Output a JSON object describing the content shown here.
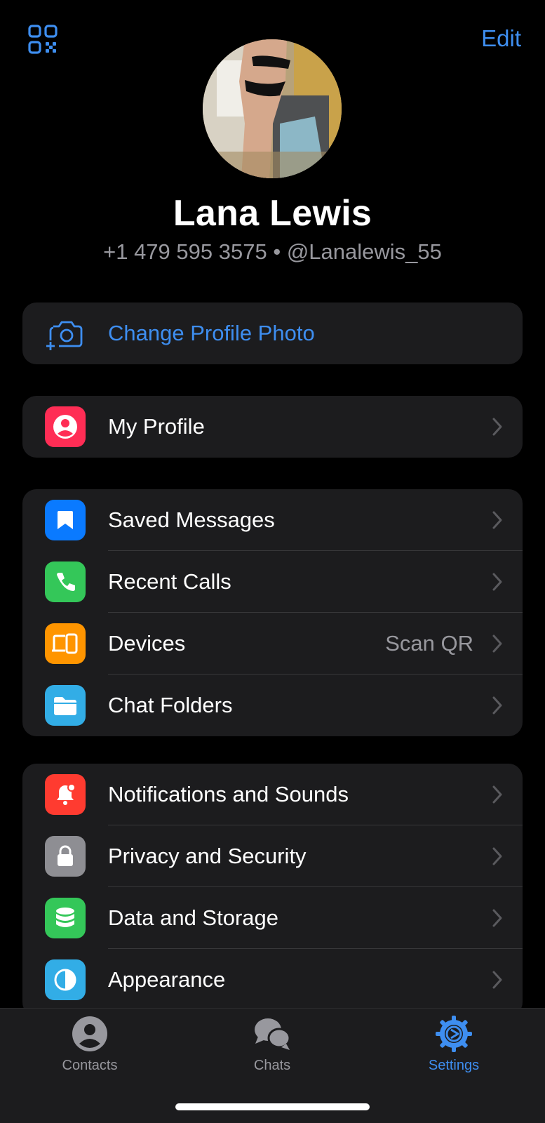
{
  "header": {
    "edit_label": "Edit"
  },
  "profile": {
    "name": "Lana Lewis",
    "phone": "+1 479 595 3575",
    "separator": "•",
    "username": "@Lanalewis_55"
  },
  "change_photo": {
    "label": "Change Profile Photo"
  },
  "group_profile": [
    {
      "label": "My Profile",
      "icon": "person-icon",
      "color": "#ff2d55"
    }
  ],
  "group_main": [
    {
      "label": "Saved Messages",
      "icon": "bookmark-icon",
      "color": "#0a7aff"
    },
    {
      "label": "Recent Calls",
      "icon": "phone-icon",
      "color": "#34c759"
    },
    {
      "label": "Devices",
      "value": "Scan QR",
      "icon": "devices-icon",
      "color": "#ff9500"
    },
    {
      "label": "Chat Folders",
      "icon": "folder-icon",
      "color": "#32ade6"
    }
  ],
  "group_settings": [
    {
      "label": "Notifications and Sounds",
      "icon": "bell-icon",
      "color": "#ff3b30"
    },
    {
      "label": "Privacy and Security",
      "icon": "lock-icon",
      "color": "#8e8e93"
    },
    {
      "label": "Data and Storage",
      "icon": "database-icon",
      "color": "#34c759"
    },
    {
      "label": "Appearance",
      "icon": "appearance-icon",
      "color": "#32ade6"
    }
  ],
  "tabbar": {
    "tabs": [
      {
        "label": "Contacts",
        "icon": "contacts-icon",
        "active": false
      },
      {
        "label": "Chats",
        "icon": "chats-icon",
        "active": false
      },
      {
        "label": "Settings",
        "icon": "settings-gear-icon",
        "active": true
      }
    ]
  },
  "colors": {
    "accent": "#3e8ef0",
    "background": "#000000",
    "cell": "#1c1c1e",
    "secondary_text": "#98989e"
  }
}
